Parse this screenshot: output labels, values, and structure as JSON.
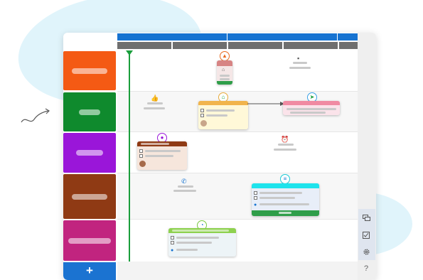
{
  "colors": {
    "header_blue": "#1673d1",
    "header_gray": "#6f6f6f",
    "lanes": [
      "#f45a14",
      "#0f8a2d",
      "#9a16d9",
      "#8f3a14",
      "#c1247f"
    ],
    "timeline": "#1a9e3c",
    "add_button": "#1b73d1"
  },
  "add_lane_button": {
    "label": "+"
  },
  "sidebar": {
    "help_label": "?"
  },
  "icons": [
    "warning-icon",
    "document-icon",
    "thumbs-up-icon",
    "home-icon",
    "send-icon",
    "alarm-icon",
    "phone-icon",
    "calendar-icon",
    "person-icon",
    "comment-icon",
    "checkbox-icon",
    "gear-icon"
  ]
}
